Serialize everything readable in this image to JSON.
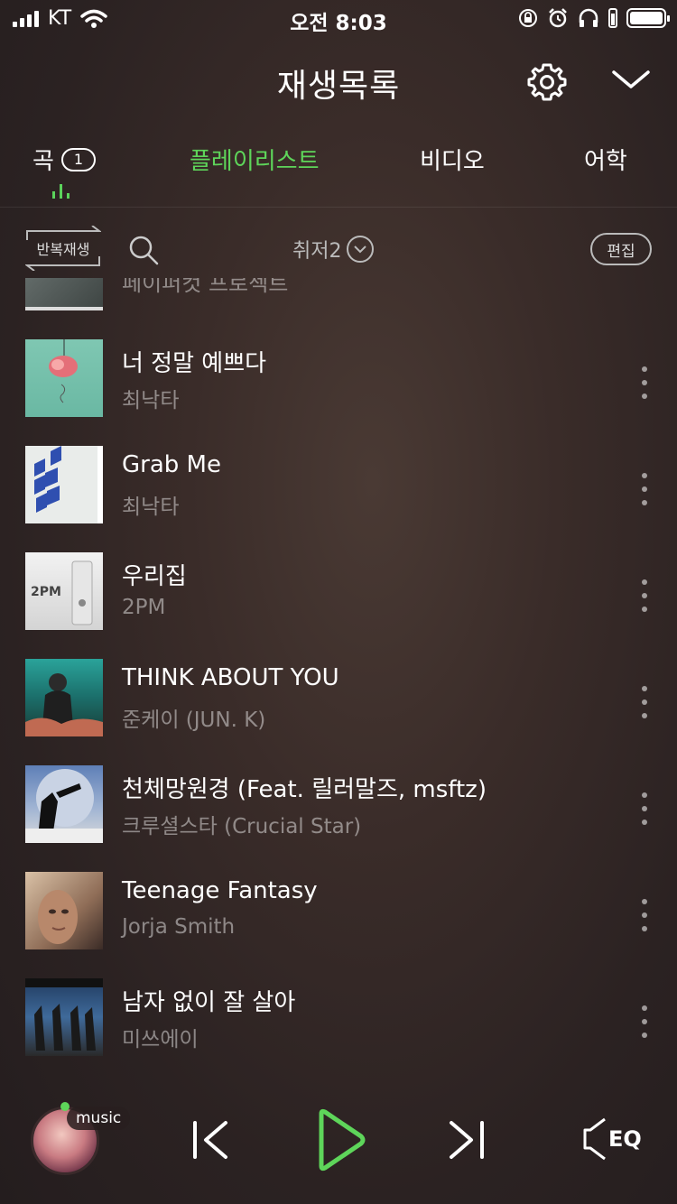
{
  "status_bar": {
    "carrier": "KT",
    "time": "오전 8:03"
  },
  "header": {
    "title": "재생목록"
  },
  "tabs": [
    {
      "label": "곡",
      "badge": "1"
    },
    {
      "label": "플레이리스트",
      "active": true
    },
    {
      "label": "비디오"
    },
    {
      "label": "어학"
    }
  ],
  "toolbar": {
    "repeat_label": "반복재생",
    "sort_label": "취저2",
    "edit_label": "편집"
  },
  "partial_item": {
    "title": "페이퍼컷 프로젝트"
  },
  "songs": [
    {
      "title": "너 정말 예쁘다",
      "artist": "최낙타"
    },
    {
      "title": "Grab Me",
      "artist": "최낙타"
    },
    {
      "title": "우리집",
      "artist": "2PM"
    },
    {
      "title": "THINK ABOUT YOU",
      "artist": "준케이 (JUN. K)"
    },
    {
      "title": "천체망원경 (Feat. 릴러말즈, msftz)",
      "artist": "크루셜스타 (Crucial Star)"
    },
    {
      "title": "Teenage Fantasy",
      "artist": "Jorja Smith"
    },
    {
      "title": "남자 없이 잘 살아",
      "artist": "미쓰에이"
    }
  ],
  "player": {
    "source_tag": "music",
    "eq_label": "EQ"
  },
  "colors": {
    "accent": "#5ed55a"
  }
}
